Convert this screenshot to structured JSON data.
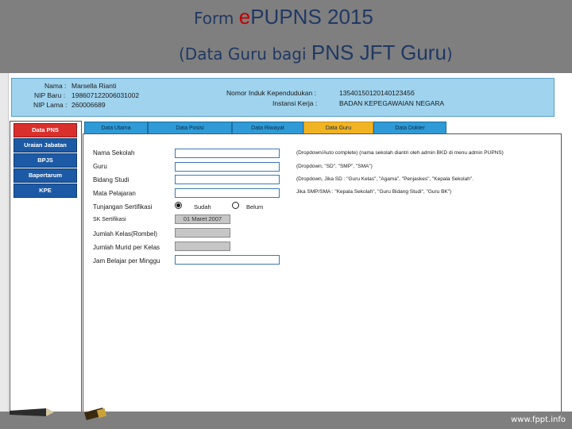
{
  "slide": {
    "title_word1": "Form ",
    "title_e": "e",
    "title_word2": "PUPNS 2015",
    "subtitle_part1": "(Data Guru bagi ",
    "subtitle_part2": "PNS JFT Guru",
    "subtitle_part3": ")",
    "footer_site": "www.fppt.info"
  },
  "header": {
    "nama_label": "Nama  :",
    "nama_value": "Marsella Rianti",
    "nip_baru_label": "NIP Baru  :",
    "nip_baru_value": "198607122006031002",
    "nip_lama_label": "NIP Lama  :",
    "nip_lama_value": "260006689",
    "nik_label": "Nomor Induk Kependudukan  :",
    "nik_value": "1354015012014012345б",
    "instansi_label": "Instansi Kerja  :",
    "instansi_value": "BADAN KEPEGAWAIAN NEGARA"
  },
  "nav": {
    "items": [
      "Data PNS",
      "Uraian Jabatan",
      "BPJS",
      "Bapertarum",
      "KPE"
    ],
    "active": "Data PNS"
  },
  "tabs": {
    "items": [
      "Data Utama",
      "Data Posisi",
      "Data Riwayat",
      "Data Guru",
      "Data Dokter"
    ],
    "active": "Data Guru"
  },
  "form": {
    "nama_sekolah": "Nama Sekolah",
    "guru": "Guru",
    "bidang_studi": "Bidang Studi",
    "mata_pelajaran": "Mata Pelajaran",
    "tunjangan": "Tunjangan Sertifikasi",
    "sudah": "Sudah",
    "belum": "Belum",
    "sk_label": "SK Sertifikasi",
    "sk_value": "01 Maret 2007",
    "jumlah_kelas": "Jumlah Kelas(Rombel)",
    "jumlah_murid": "Jumlah Murid per Kelas",
    "jam_belajar": "Jam Belajar per Minggu"
  },
  "notes": {
    "nama_sekolah": "(Dropdown/Auto complete) (nama sekolah diantri oleh admin BKD di menu admin PUPNS)",
    "guru": "(Dropdown, \"SD\", \"SMP\", \"SMA\")",
    "bidang_studi": "(Dropdown, Jika SD : \"Guru Kelas\", \"Agama\", \"Penjaskes\", \"Kepala Sekolah\".",
    "mata_pelajaran": "Jika SMP/SMA : \"Kepala Sekolah\", \"Guru Bidang Studi\", \"Guru BK\")"
  }
}
